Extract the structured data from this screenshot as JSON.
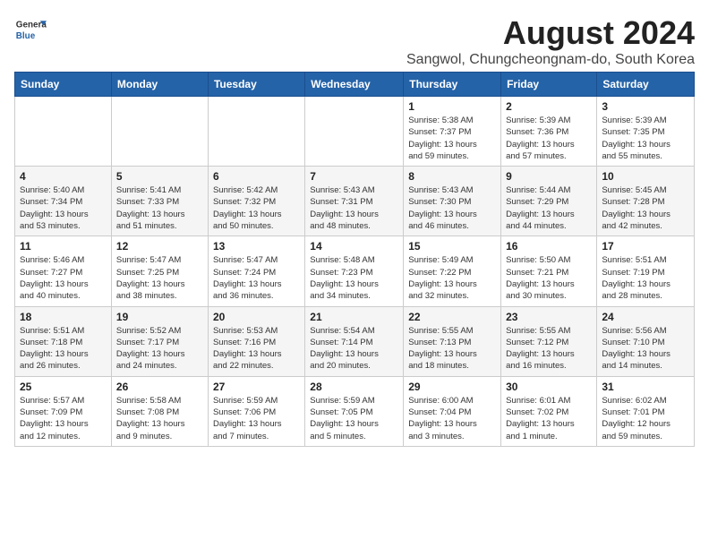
{
  "logo": {
    "line1": "General",
    "line2": "Blue"
  },
  "title": "August 2024",
  "subtitle": "Sangwol, Chungcheongnam-do, South Korea",
  "days_of_week": [
    "Sunday",
    "Monday",
    "Tuesday",
    "Wednesday",
    "Thursday",
    "Friday",
    "Saturday"
  ],
  "weeks": [
    [
      {
        "day": "",
        "info": ""
      },
      {
        "day": "",
        "info": ""
      },
      {
        "day": "",
        "info": ""
      },
      {
        "day": "",
        "info": ""
      },
      {
        "day": "1",
        "info": "Sunrise: 5:38 AM\nSunset: 7:37 PM\nDaylight: 13 hours\nand 59 minutes."
      },
      {
        "day": "2",
        "info": "Sunrise: 5:39 AM\nSunset: 7:36 PM\nDaylight: 13 hours\nand 57 minutes."
      },
      {
        "day": "3",
        "info": "Sunrise: 5:39 AM\nSunset: 7:35 PM\nDaylight: 13 hours\nand 55 minutes."
      }
    ],
    [
      {
        "day": "4",
        "info": "Sunrise: 5:40 AM\nSunset: 7:34 PM\nDaylight: 13 hours\nand 53 minutes."
      },
      {
        "day": "5",
        "info": "Sunrise: 5:41 AM\nSunset: 7:33 PM\nDaylight: 13 hours\nand 51 minutes."
      },
      {
        "day": "6",
        "info": "Sunrise: 5:42 AM\nSunset: 7:32 PM\nDaylight: 13 hours\nand 50 minutes."
      },
      {
        "day": "7",
        "info": "Sunrise: 5:43 AM\nSunset: 7:31 PM\nDaylight: 13 hours\nand 48 minutes."
      },
      {
        "day": "8",
        "info": "Sunrise: 5:43 AM\nSunset: 7:30 PM\nDaylight: 13 hours\nand 46 minutes."
      },
      {
        "day": "9",
        "info": "Sunrise: 5:44 AM\nSunset: 7:29 PM\nDaylight: 13 hours\nand 44 minutes."
      },
      {
        "day": "10",
        "info": "Sunrise: 5:45 AM\nSunset: 7:28 PM\nDaylight: 13 hours\nand 42 minutes."
      }
    ],
    [
      {
        "day": "11",
        "info": "Sunrise: 5:46 AM\nSunset: 7:27 PM\nDaylight: 13 hours\nand 40 minutes."
      },
      {
        "day": "12",
        "info": "Sunrise: 5:47 AM\nSunset: 7:25 PM\nDaylight: 13 hours\nand 38 minutes."
      },
      {
        "day": "13",
        "info": "Sunrise: 5:47 AM\nSunset: 7:24 PM\nDaylight: 13 hours\nand 36 minutes."
      },
      {
        "day": "14",
        "info": "Sunrise: 5:48 AM\nSunset: 7:23 PM\nDaylight: 13 hours\nand 34 minutes."
      },
      {
        "day": "15",
        "info": "Sunrise: 5:49 AM\nSunset: 7:22 PM\nDaylight: 13 hours\nand 32 minutes."
      },
      {
        "day": "16",
        "info": "Sunrise: 5:50 AM\nSunset: 7:21 PM\nDaylight: 13 hours\nand 30 minutes."
      },
      {
        "day": "17",
        "info": "Sunrise: 5:51 AM\nSunset: 7:19 PM\nDaylight: 13 hours\nand 28 minutes."
      }
    ],
    [
      {
        "day": "18",
        "info": "Sunrise: 5:51 AM\nSunset: 7:18 PM\nDaylight: 13 hours\nand 26 minutes."
      },
      {
        "day": "19",
        "info": "Sunrise: 5:52 AM\nSunset: 7:17 PM\nDaylight: 13 hours\nand 24 minutes."
      },
      {
        "day": "20",
        "info": "Sunrise: 5:53 AM\nSunset: 7:16 PM\nDaylight: 13 hours\nand 22 minutes."
      },
      {
        "day": "21",
        "info": "Sunrise: 5:54 AM\nSunset: 7:14 PM\nDaylight: 13 hours\nand 20 minutes."
      },
      {
        "day": "22",
        "info": "Sunrise: 5:55 AM\nSunset: 7:13 PM\nDaylight: 13 hours\nand 18 minutes."
      },
      {
        "day": "23",
        "info": "Sunrise: 5:55 AM\nSunset: 7:12 PM\nDaylight: 13 hours\nand 16 minutes."
      },
      {
        "day": "24",
        "info": "Sunrise: 5:56 AM\nSunset: 7:10 PM\nDaylight: 13 hours\nand 14 minutes."
      }
    ],
    [
      {
        "day": "25",
        "info": "Sunrise: 5:57 AM\nSunset: 7:09 PM\nDaylight: 13 hours\nand 12 minutes."
      },
      {
        "day": "26",
        "info": "Sunrise: 5:58 AM\nSunset: 7:08 PM\nDaylight: 13 hours\nand 9 minutes."
      },
      {
        "day": "27",
        "info": "Sunrise: 5:59 AM\nSunset: 7:06 PM\nDaylight: 13 hours\nand 7 minutes."
      },
      {
        "day": "28",
        "info": "Sunrise: 5:59 AM\nSunset: 7:05 PM\nDaylight: 13 hours\nand 5 minutes."
      },
      {
        "day": "29",
        "info": "Sunrise: 6:00 AM\nSunset: 7:04 PM\nDaylight: 13 hours\nand 3 minutes."
      },
      {
        "day": "30",
        "info": "Sunrise: 6:01 AM\nSunset: 7:02 PM\nDaylight: 13 hours\nand 1 minute."
      },
      {
        "day": "31",
        "info": "Sunrise: 6:02 AM\nSunset: 7:01 PM\nDaylight: 12 hours\nand 59 minutes."
      }
    ]
  ]
}
